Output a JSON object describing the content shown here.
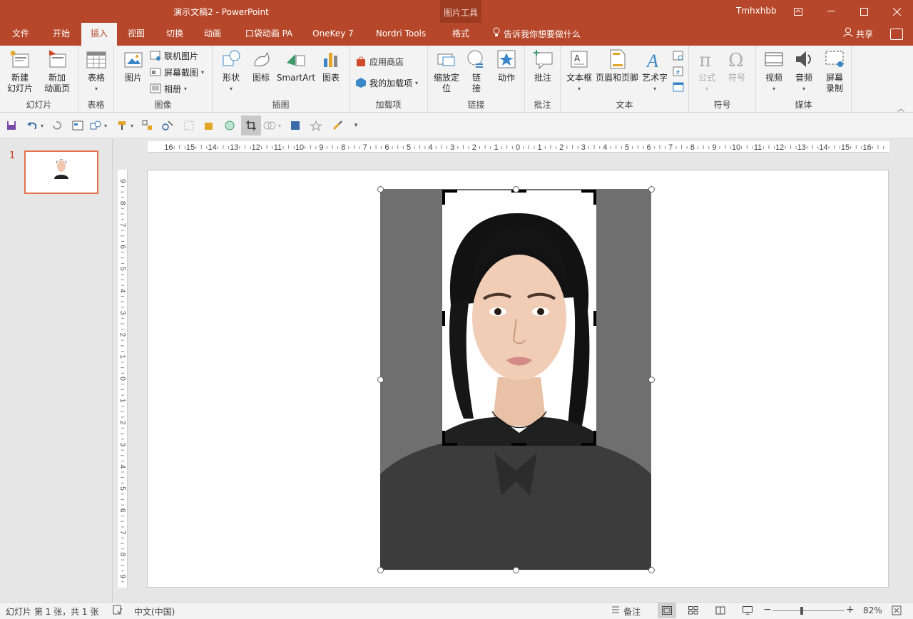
{
  "window": {
    "title": "演示文稿2  -  PowerPoint",
    "context_group": "图片工具",
    "user": "Tmhxhbb"
  },
  "tabs": [
    {
      "label": "文件"
    },
    {
      "label": "开始"
    },
    {
      "label": "插入",
      "active": true
    },
    {
      "label": "视图"
    },
    {
      "label": "切换"
    },
    {
      "label": "动画"
    },
    {
      "label": "口袋动画 PA"
    },
    {
      "label": "OneKey 7"
    },
    {
      "label": "Nordri Tools"
    },
    {
      "label": "格式"
    }
  ],
  "tellme": "告诉我你想要做什么",
  "share": "共享",
  "ribbon": {
    "slides": {
      "label": "幻灯片",
      "new_slide": "新建\n幻灯片",
      "new_anim": "新加\n动画页"
    },
    "table": {
      "label": "表格",
      "btn": "表格"
    },
    "images": {
      "label": "图像",
      "picture": "图片",
      "online": "联机图片",
      "screenshot": "屏幕截图",
      "album": "相册"
    },
    "illustrations": {
      "label": "插图",
      "shapes": "形状",
      "icons": "图标",
      "smartart": "SmartArt",
      "chart": "图表"
    },
    "addins": {
      "label": "加载项",
      "store": "应用商店",
      "my_addins": "我的加载项"
    },
    "links": {
      "label": "链接",
      "zoom": "缩放定\n位",
      "link": "链\n接",
      "action": "动作"
    },
    "comments": {
      "label": "批注",
      "btn": "批注"
    },
    "text": {
      "label": "文本",
      "textbox": "文本框",
      "headerfooter": "页眉和页脚",
      "wordart": "艺术字"
    },
    "symbols": {
      "label": "符号",
      "equation": "公式",
      "symbol": "符号"
    },
    "media": {
      "label": "媒体",
      "video": "视频",
      "audio": "音频",
      "record": "屏幕\n录制"
    }
  },
  "slide_panel": {
    "number": "1"
  },
  "status": {
    "slide_info": "幻灯片 第 1 张，共 1 张",
    "language": "中文(中国)",
    "notes": "备注",
    "zoom": "82%"
  },
  "colors": {
    "accent": "#b7472a",
    "crop_border": "#000000"
  }
}
